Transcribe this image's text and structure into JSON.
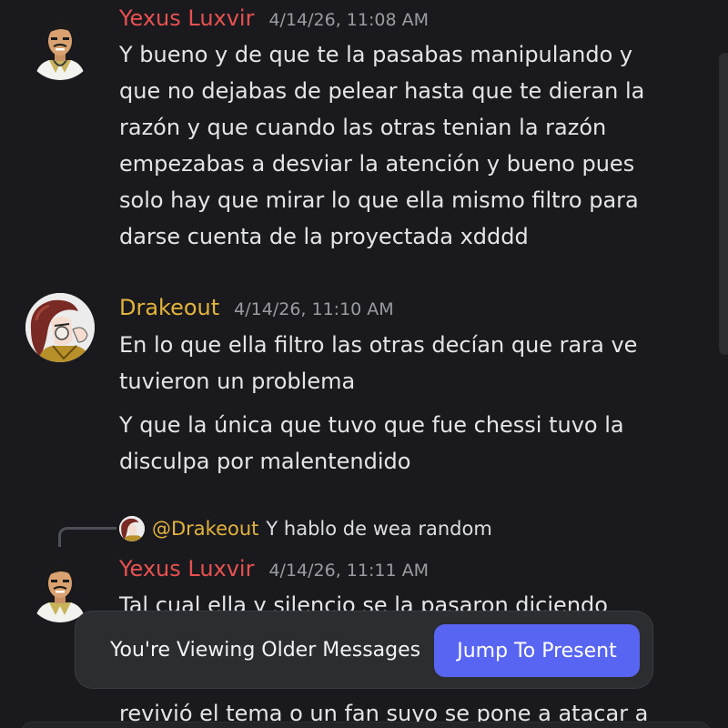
{
  "messages": [
    {
      "username": "Yexus Luxvir",
      "username_color": "#e8514f",
      "timestamp": "4/14/26, 11:08 AM",
      "avatar_icon": "cartoon-man-avatar-icon",
      "paragraphs": [
        [
          "Y bueno y de que te la pasabas manipulando y",
          "que no dejabas de pelear hasta que te dieran la",
          "razón y que cuando las otras tenian la razón",
          "empezabas a desviar la atención y bueno pues",
          "solo hay que mirar lo que ella mismo filtro para",
          "darse cuenta de la proyectada  xdddd"
        ]
      ]
    },
    {
      "username": "Drakeout",
      "username_color": "#e3b33c",
      "timestamp": "4/14/26, 11:10 AM",
      "avatar_icon": "anime-character-avatar-icon",
      "paragraphs": [
        [
          "En lo que ella filtro las otras decían que rara ve",
          "tuvieron un problema"
        ],
        [
          "Y que la única que tuvo que fue chessi tuvo la",
          "disculpa por malentendido"
        ]
      ]
    },
    {
      "reply_to": {
        "mention": "@Drakeout",
        "text": "Y hablo de wea random",
        "avatar_icon": "anime-character-avatar-icon"
      },
      "username": "Yexus Luxvir",
      "username_color": "#e8514f",
      "timestamp": "4/14/26, 11:11 AM",
      "avatar_icon": "cartoon-man-avatar-icon",
      "paragraphs": [
        [
          "Tal cual ella y silencio se la pasaron diciendo"
        ]
      ],
      "trailing_text": "revivió el tema o un fan suyo se pone a atacar a"
    }
  ],
  "banner": {
    "text": "You're Viewing Older Messages",
    "button_label": "Jump To Present",
    "button_color": "#5865f2"
  },
  "colors": {
    "background": "#1a1a1e",
    "timestamp": "#9a9ca2"
  }
}
